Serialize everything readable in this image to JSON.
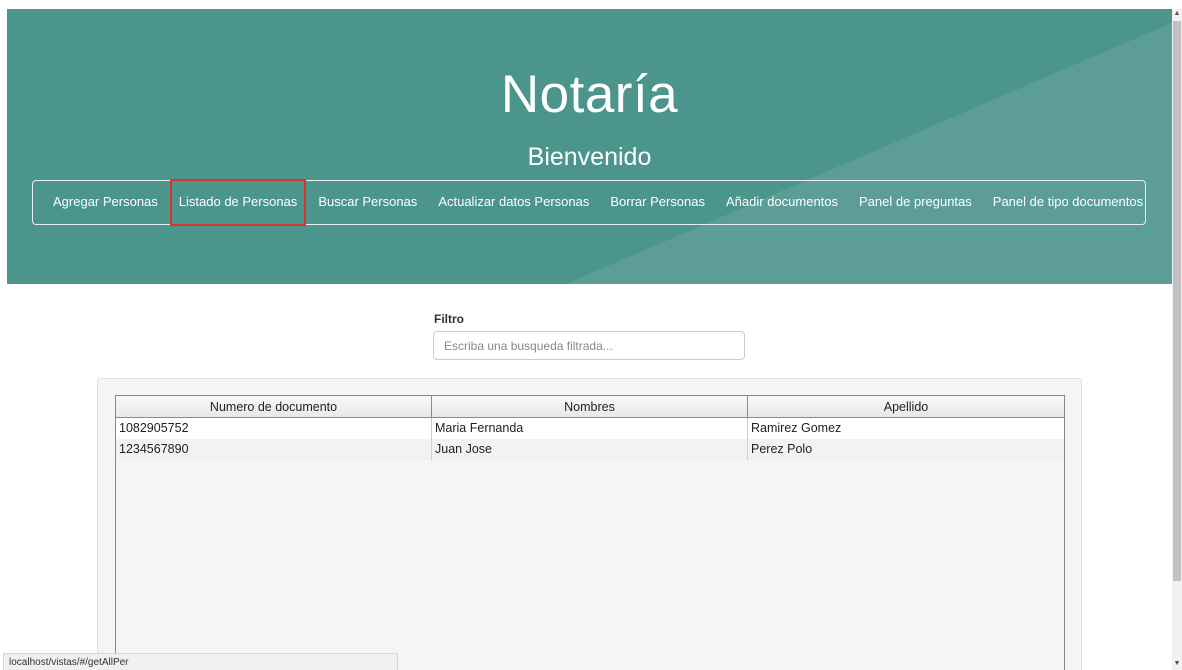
{
  "header": {
    "title": "Notaría",
    "subtitle": "Bienvenido",
    "nav": [
      {
        "label": "Agregar Personas"
      },
      {
        "label": "Listado de Personas",
        "active": true
      },
      {
        "label": "Buscar Personas"
      },
      {
        "label": "Actualizar datos Personas"
      },
      {
        "label": "Borrar Personas"
      },
      {
        "label": "Añadir documentos"
      },
      {
        "label": "Panel de preguntas"
      },
      {
        "label": "Panel de tipo documentos"
      }
    ]
  },
  "filter": {
    "label": "Filtro",
    "placeholder": "Escriba una busqueda filtrada..."
  },
  "table": {
    "columns": [
      "Numero de documento",
      "Nombres",
      "Apellido"
    ],
    "rows": [
      [
        "1082905752",
        "Maria Fernanda",
        "Ramirez Gomez"
      ],
      [
        "1234567890",
        "Juan Jose",
        "Perez Polo"
      ]
    ]
  },
  "status_bar": {
    "url": "localhost/vistas/#/getAllPer"
  },
  "icons": {
    "scroll_up": "▲",
    "scroll_down": "▼"
  },
  "colors": {
    "header_bg": "#4b958d",
    "active_outline": "#e0302e"
  }
}
